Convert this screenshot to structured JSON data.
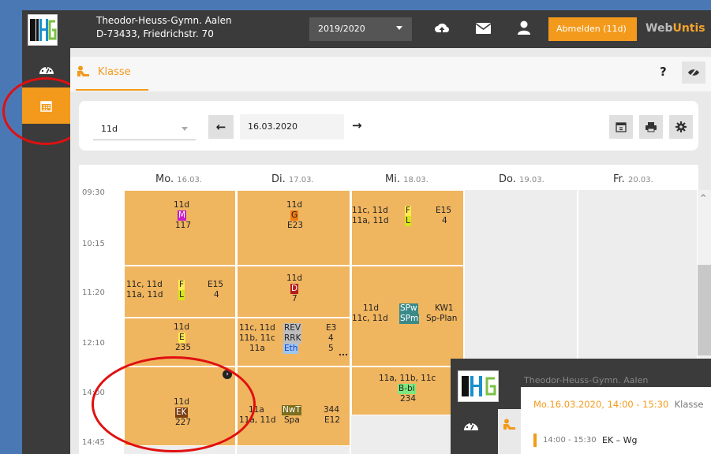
{
  "header": {
    "logo_text": "THG",
    "school_name": "Theodor-Heuss-Gymn. Aalen",
    "school_address": "D-73433, Friedrichstr. 70",
    "school_year": "2019/2020",
    "logout_label": "Abmelden (11d)",
    "brand_web": "Web",
    "brand_untis": "Untis"
  },
  "subheader": {
    "tab_label": "Klasse",
    "help_label": "?"
  },
  "toolbar": {
    "class_value": "11d",
    "date_value": "16.03.2020"
  },
  "days": [
    {
      "name": "Mo.",
      "date": "16.03."
    },
    {
      "name": "Di.",
      "date": "17.03."
    },
    {
      "name": "Mi.",
      "date": "18.03."
    },
    {
      "name": "Do.",
      "date": "19.03."
    },
    {
      "name": "Fr.",
      "date": "20.03."
    }
  ],
  "times": [
    "09:30",
    "10:15",
    "11:20",
    "12:10",
    "14:00",
    "14:45"
  ],
  "lessons": {
    "mo1": {
      "class": "11d",
      "subject": "M",
      "room": "117"
    },
    "mo2": {
      "classes1": "11c, 11d",
      "subject1": "F",
      "room1": "E15",
      "classes2": "11a, 11d",
      "subject2": "L",
      "room2": "4"
    },
    "mo3": {
      "class": "11d",
      "subject": "E",
      "room": "235"
    },
    "mo4": {
      "class": "11d",
      "subject": "EK",
      "room": "227"
    },
    "di1": {
      "class": "11d",
      "subject": "G",
      "room": "E23"
    },
    "di2": {
      "class": "11d",
      "subject": "D",
      "room": "7"
    },
    "di3": {
      "classes1": "11c, 11d",
      "subject1": "REV",
      "room1": "E3",
      "classes2": "11b, 11c",
      "subject2": "RRK",
      "room2": "4",
      "classes3": "11a",
      "subject3": "Eth",
      "room3": "5",
      "more": "..."
    },
    "di4": {
      "classes1": "11a",
      "subject1": "NwT",
      "room1": "344",
      "classes2": "11a, 11d",
      "subject2": "Spa",
      "room2": "E12"
    },
    "mi1": {
      "classes1": "11c, 11d",
      "subject1": "F",
      "room1": "E15",
      "classes2": "11a, 11d",
      "subject2": "L",
      "room2": "4"
    },
    "mi2": {
      "classes1": "11d",
      "subject1": "SPw",
      "room1": "KW1",
      "classes2": "11c, 11d",
      "subject2": "SPm",
      "room2": "Sp-Plan"
    },
    "mi3": {
      "classes": "11a, 11b, 11c",
      "subject": "B-bi",
      "room": "234"
    }
  },
  "popup": {
    "school_name": "Theodor-Heuss-Gymn. Aalen",
    "title": "Mo.16.03.2020, 14:00 - 15:30",
    "title_suffix": "Klasse",
    "line_time": "14:00 - 15:30",
    "line_lesson": "EK – Wg"
  },
  "colors": {
    "accent": "#f39a1c",
    "lesson": "#f0b55f",
    "header": "#3b3b3b",
    "highlight_ring": "#e01010"
  }
}
